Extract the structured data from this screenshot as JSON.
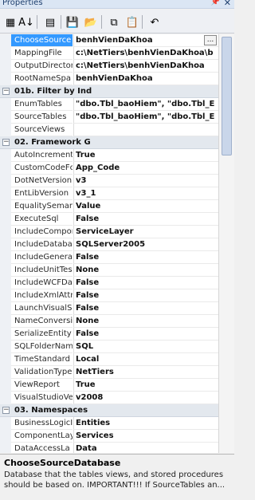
{
  "window": {
    "title": "Properties",
    "pin_glyph": "📌",
    "close_glyph": "✕"
  },
  "toolbar": {
    "buttons": [
      {
        "icon": "categorized-icon",
        "glyph": "▦"
      },
      {
        "icon": "alphabetical-icon",
        "glyph": "A↓"
      },
      {
        "icon": "property-pages-icon",
        "glyph": "▤"
      },
      {
        "icon": "save-icon",
        "glyph": "💾"
      },
      {
        "icon": "open-icon",
        "glyph": "📂"
      },
      {
        "icon": "copy-icon",
        "glyph": "⧉"
      },
      {
        "icon": "paste-icon",
        "glyph": "📋"
      },
      {
        "icon": "undo-icon",
        "glyph": "↶"
      }
    ]
  },
  "grid": {
    "items": [
      {
        "kind": "prop",
        "name": "ChooseSource",
        "value": "benhVienDaKhoa",
        "selected": true,
        "ellipsis": "..."
      },
      {
        "kind": "prop",
        "name": "MappingFile",
        "value": "c:\\NetTiers\\benhVienDaKhoa\\b"
      },
      {
        "kind": "prop",
        "name": "OutputDirector",
        "value": "c:\\NetTiers\\benhVienDaKhoa"
      },
      {
        "kind": "prop",
        "name": "RootNameSpa",
        "value": "benhVienDaKhoa"
      },
      {
        "kind": "cat",
        "label": "01b. Filter by Ind",
        "exp": "−"
      },
      {
        "kind": "prop",
        "name": "EnumTables",
        "value": "\"dbo.Tbl_baoHiem\", \"dbo.Tbl_E"
      },
      {
        "kind": "prop",
        "name": "SourceTables",
        "value": "\"dbo.Tbl_baoHiem\", \"dbo.Tbl_E"
      },
      {
        "kind": "prop",
        "name": "SourceViews",
        "value": ""
      },
      {
        "kind": "cat",
        "label": "02. Framework G",
        "exp": "−"
      },
      {
        "kind": "prop",
        "name": "AutoIncrement",
        "value": "True"
      },
      {
        "kind": "prop",
        "name": "CustomCodeFc",
        "value": "App_Code"
      },
      {
        "kind": "prop",
        "name": "DotNetVersion",
        "value": "v3"
      },
      {
        "kind": "prop",
        "name": "EntLibVersion",
        "value": "v3_1"
      },
      {
        "kind": "prop",
        "name": "EqualitySeman",
        "value": "Value"
      },
      {
        "kind": "prop",
        "name": "ExecuteSql",
        "value": "False"
      },
      {
        "kind": "prop",
        "name": "IncludeCompor",
        "value": "ServiceLayer"
      },
      {
        "kind": "prop",
        "name": "IncludeDataba",
        "value": "SQLServer2005"
      },
      {
        "kind": "prop",
        "name": "IncludeGenera",
        "value": "False"
      },
      {
        "kind": "prop",
        "name": "IncludeUnitTes",
        "value": "None"
      },
      {
        "kind": "prop",
        "name": "IncludeWCFDa",
        "value": "False"
      },
      {
        "kind": "prop",
        "name": "IncludeXmlAttri",
        "value": "False"
      },
      {
        "kind": "prop",
        "name": "LaunchVisualS",
        "value": "False"
      },
      {
        "kind": "prop",
        "name": "NameConversi",
        "value": "None"
      },
      {
        "kind": "prop",
        "name": "SerializeEntity",
        "value": "False"
      },
      {
        "kind": "prop",
        "name": "SQLFolderNam",
        "value": "SQL"
      },
      {
        "kind": "prop",
        "name": "TimeStandard",
        "value": "Local"
      },
      {
        "kind": "prop",
        "name": "ValidationType",
        "value": "NetTiers"
      },
      {
        "kind": "prop",
        "name": "ViewReport",
        "value": "True"
      },
      {
        "kind": "prop",
        "name": "VisualStudioVe",
        "value": "v2008"
      },
      {
        "kind": "cat",
        "label": "03. Namespaces",
        "exp": "−"
      },
      {
        "kind": "prop",
        "name": "BusinessLogicI",
        "value": "Entities"
      },
      {
        "kind": "prop",
        "name": "ComponentLay",
        "value": "Services"
      },
      {
        "kind": "prop",
        "name": "DataAccessLa",
        "value": "Data"
      }
    ]
  },
  "help": {
    "title": "ChooseSourceDatabase",
    "description": "Database that the tables views, and stored procedures should be based on. IMPORTANT!!! If SourceTables an..."
  }
}
